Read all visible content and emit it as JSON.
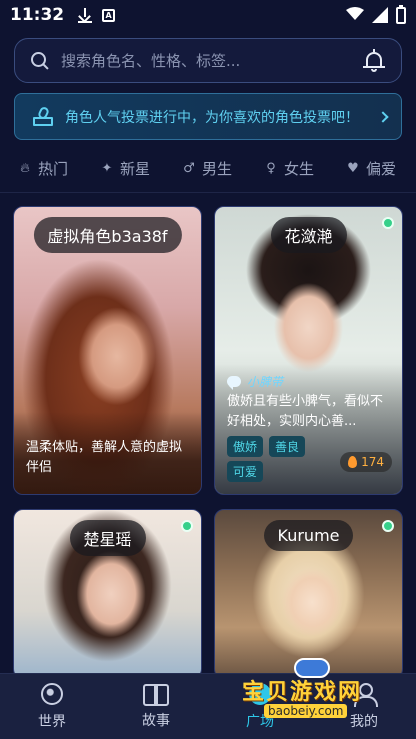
{
  "status_bar": {
    "time": "11:32",
    "a_glyph": "A"
  },
  "search": {
    "placeholder": "搜索角色名、性格、标签..."
  },
  "banner": {
    "text": "角色人气投票进行中，为你喜欢的角色投票吧！"
  },
  "tabs": [
    {
      "label": "热门",
      "icon": "flame-icon"
    },
    {
      "label": "新星",
      "icon": "sparkle-icon"
    },
    {
      "label": "男生",
      "icon": "male-icon"
    },
    {
      "label": "女生",
      "icon": "female-icon"
    },
    {
      "label": "偏爱",
      "icon": "heart-icon"
    }
  ],
  "cards": [
    {
      "name": "虚拟角色b3a38f",
      "online": false,
      "description": "温柔体贴，善解人意的虚拟伴侣"
    },
    {
      "name": "花潋滟",
      "online": true,
      "tagline": "小脾带",
      "description": "傲娇且有些小脾气，看似不好相处，实则内心善...",
      "tags": [
        "傲娇",
        "善良",
        "可爱"
      ],
      "heat": "174"
    },
    {
      "name": "楚星瑶",
      "online": true
    },
    {
      "name": "Kurume",
      "online": true
    }
  ],
  "bottom_nav": [
    {
      "label": "世界",
      "icon": "globe-icon",
      "active": false
    },
    {
      "label": "故事",
      "icon": "book-icon",
      "active": false
    },
    {
      "label": "广场",
      "icon": "plaza-icon",
      "active": true
    },
    {
      "label": "我的",
      "icon": "profile-icon",
      "active": false
    }
  ],
  "watermark": {
    "title": "宝贝游戏网",
    "url": "baobeiy.com"
  },
  "colors": {
    "background": "#0e1330",
    "accent": "#2ec7e8",
    "banner_text": "#5fd0f0",
    "online": "#35d08a",
    "heat": "#ffb040"
  }
}
